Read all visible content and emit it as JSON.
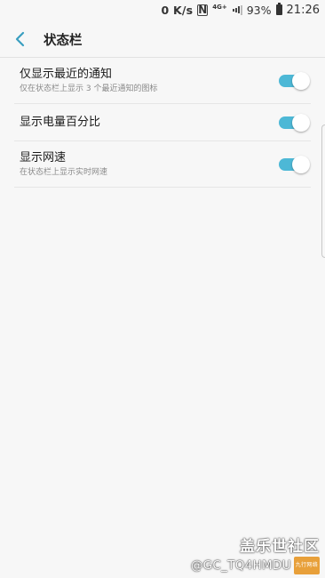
{
  "status_bar": {
    "net_speed": "0 K/s",
    "nfc_label": "N",
    "network_label": "4G+",
    "battery_percent": "93%",
    "time": "21:26"
  },
  "header": {
    "back_icon": "chevron-left-icon",
    "title": "状态栏"
  },
  "settings": [
    {
      "title": "仅显示最近的通知",
      "subtitle": "仅在状态栏上显示 3 个最近通知的图标",
      "enabled": true
    },
    {
      "title": "显示电量百分比",
      "subtitle": "",
      "enabled": true
    },
    {
      "title": "显示网速",
      "subtitle": "在状态栏上显示实时网速",
      "enabled": true
    }
  ],
  "colors": {
    "accent": "#4db8d6",
    "back_arrow": "#3a9fc0",
    "background": "#f7f7f7"
  },
  "watermark": {
    "community": "盖乐世社区",
    "user": "@GC_TQ4HMDU",
    "badge": "九行网络"
  }
}
